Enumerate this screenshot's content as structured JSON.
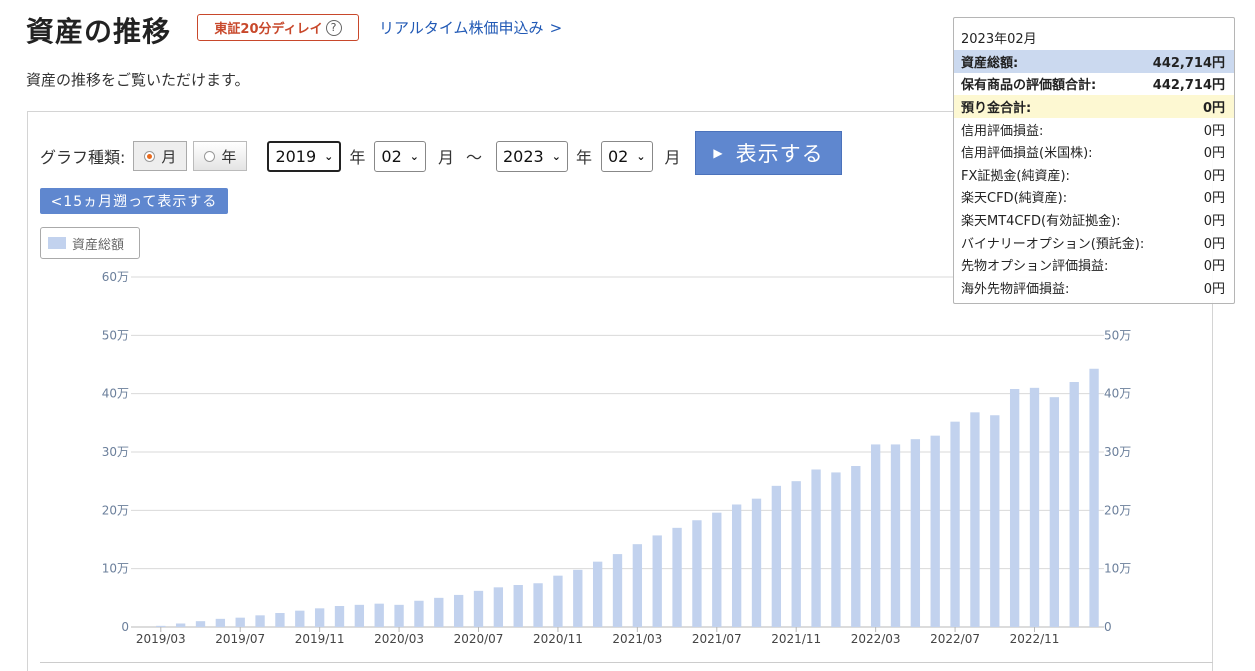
{
  "header": {
    "title": "資産の推移",
    "delay_badge": "東証20分ディレイ",
    "help_icon": "question-circle-icon",
    "realtime_link": "リアルタイム株価申込み",
    "subtitle": "資産の推移をご覧いただけます。"
  },
  "controls": {
    "graph_type_label": "グラフ種類:",
    "month_label": "月",
    "year_label": "年",
    "selected_type": "月",
    "from_year": "2019",
    "from_month": "02",
    "to_year": "2023",
    "to_month": "02",
    "year_unit": "年",
    "month_unit": "月",
    "tilde": "〜",
    "show_button": "表示する",
    "back_button": "<15ヵ月遡って表示する"
  },
  "legend": {
    "label": "資産総額"
  },
  "colors": {
    "bar": "#c2d2ee",
    "accent_button": "#5f87cf",
    "badge": "#c8482b",
    "link": "#2159b5",
    "grid": "#d9d9d9"
  },
  "chart_data": {
    "type": "bar",
    "title": "",
    "xlabel": "",
    "ylabel": "",
    "ylim": [
      0,
      600000
    ],
    "y_tick_labels": [
      "0",
      "10万",
      "20万",
      "30万",
      "40万",
      "50万",
      "60万"
    ],
    "right_axis_tick_labels": [
      "0",
      "10万",
      "20万",
      "30万",
      "40万",
      "50万"
    ],
    "x_tick_labels": [
      "2019/03",
      "2019/07",
      "2019/11",
      "2020/03",
      "2020/07",
      "2020/11",
      "2021/03",
      "2021/07",
      "2021/11",
      "2022/03",
      "2022/07",
      "2022/11"
    ],
    "grid": true,
    "categories": [
      "2019/02",
      "2019/03",
      "2019/04",
      "2019/05",
      "2019/06",
      "2019/07",
      "2019/08",
      "2019/09",
      "2019/10",
      "2019/11",
      "2019/12",
      "2020/01",
      "2020/02",
      "2020/03",
      "2020/04",
      "2020/05",
      "2020/06",
      "2020/07",
      "2020/08",
      "2020/09",
      "2020/10",
      "2020/11",
      "2020/12",
      "2021/01",
      "2021/02",
      "2021/03",
      "2021/04",
      "2021/05",
      "2021/06",
      "2021/07",
      "2021/08",
      "2021/09",
      "2021/10",
      "2021/11",
      "2021/12",
      "2022/01",
      "2022/02",
      "2022/03",
      "2022/04",
      "2022/05",
      "2022/06",
      "2022/07",
      "2022/08",
      "2022/09",
      "2022/10",
      "2022/11",
      "2022/12",
      "2023/01",
      "2023/02"
    ],
    "series": [
      {
        "name": "資産総額",
        "values": [
          0,
          2000,
          6000,
          10000,
          14000,
          16000,
          20000,
          24000,
          28000,
          32000,
          36000,
          38000,
          40000,
          38000,
          45000,
          50000,
          55000,
          62000,
          68000,
          72000,
          75000,
          88000,
          98000,
          112000,
          125000,
          142000,
          157000,
          170000,
          183000,
          196000,
          210000,
          220000,
          242000,
          250000,
          270000,
          265000,
          276000,
          313000,
          313000,
          322000,
          328000,
          352000,
          368000,
          363000,
          408000,
          410000,
          394000,
          420000,
          442714
        ]
      }
    ]
  },
  "tooltip": {
    "date": "2023年02月",
    "rows": [
      {
        "label": "資産総額:",
        "value": "442,714円",
        "style": "total"
      },
      {
        "label": "保有商品の評価額合計:",
        "value": "442,714円",
        "style": "bold"
      },
      {
        "label": "預り金合計:",
        "value": "0円",
        "style": "cash"
      },
      {
        "label": "信用評価損益:",
        "value": "0円",
        "style": ""
      },
      {
        "label": "信用評価損益(米国株):",
        "value": "0円",
        "style": ""
      },
      {
        "label": "FX証拠金(純資産):",
        "value": "0円",
        "style": ""
      },
      {
        "label": "楽天CFD(純資産):",
        "value": "0円",
        "style": ""
      },
      {
        "label": "楽天MT4CFD(有効証拠金):",
        "value": "0円",
        "style": ""
      },
      {
        "label": "バイナリーオプション(預託金):",
        "value": "0円",
        "style": ""
      },
      {
        "label": "先物オプション評価損益:",
        "value": "0円",
        "style": ""
      },
      {
        "label": "海外先物評価損益:",
        "value": "0円",
        "style": ""
      }
    ]
  }
}
